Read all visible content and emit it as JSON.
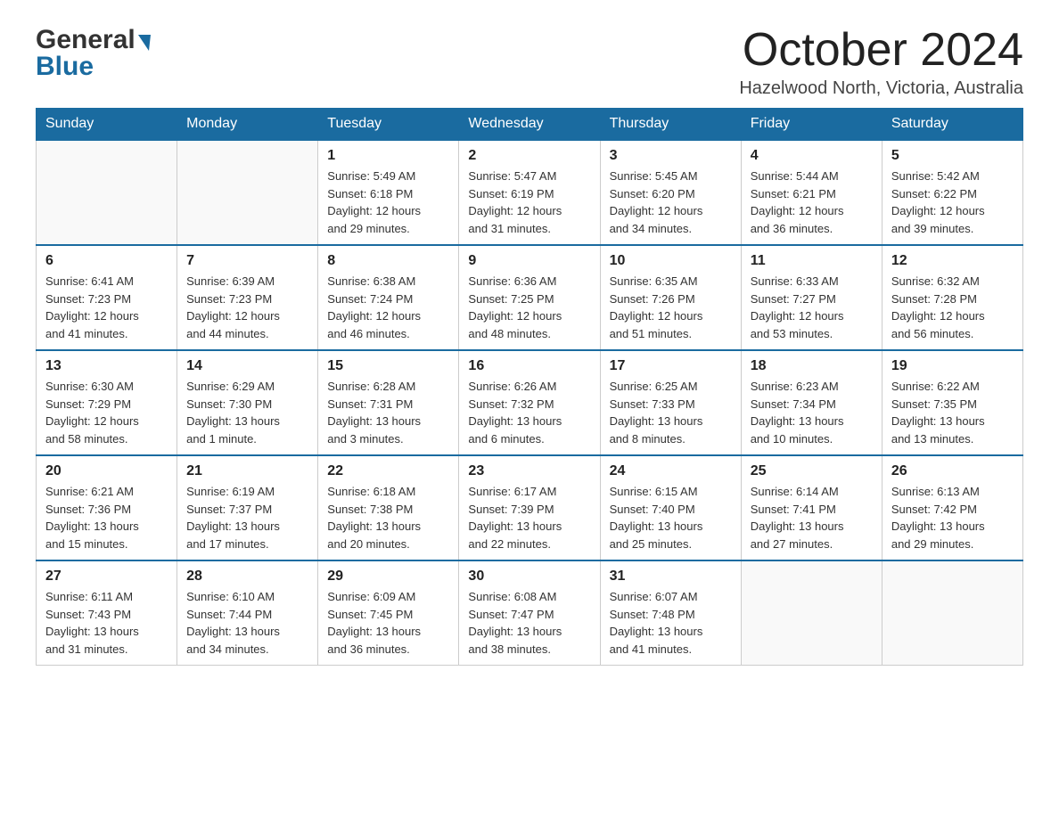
{
  "header": {
    "logo_general": "General",
    "logo_blue": "Blue",
    "month_title": "October 2024",
    "location": "Hazelwood North, Victoria, Australia"
  },
  "days_of_week": [
    "Sunday",
    "Monday",
    "Tuesday",
    "Wednesday",
    "Thursday",
    "Friday",
    "Saturday"
  ],
  "weeks": [
    [
      {
        "day": "",
        "info": ""
      },
      {
        "day": "",
        "info": ""
      },
      {
        "day": "1",
        "info": "Sunrise: 5:49 AM\nSunset: 6:18 PM\nDaylight: 12 hours\nand 29 minutes."
      },
      {
        "day": "2",
        "info": "Sunrise: 5:47 AM\nSunset: 6:19 PM\nDaylight: 12 hours\nand 31 minutes."
      },
      {
        "day": "3",
        "info": "Sunrise: 5:45 AM\nSunset: 6:20 PM\nDaylight: 12 hours\nand 34 minutes."
      },
      {
        "day": "4",
        "info": "Sunrise: 5:44 AM\nSunset: 6:21 PM\nDaylight: 12 hours\nand 36 minutes."
      },
      {
        "day": "5",
        "info": "Sunrise: 5:42 AM\nSunset: 6:22 PM\nDaylight: 12 hours\nand 39 minutes."
      }
    ],
    [
      {
        "day": "6",
        "info": "Sunrise: 6:41 AM\nSunset: 7:23 PM\nDaylight: 12 hours\nand 41 minutes."
      },
      {
        "day": "7",
        "info": "Sunrise: 6:39 AM\nSunset: 7:23 PM\nDaylight: 12 hours\nand 44 minutes."
      },
      {
        "day": "8",
        "info": "Sunrise: 6:38 AM\nSunset: 7:24 PM\nDaylight: 12 hours\nand 46 minutes."
      },
      {
        "day": "9",
        "info": "Sunrise: 6:36 AM\nSunset: 7:25 PM\nDaylight: 12 hours\nand 48 minutes."
      },
      {
        "day": "10",
        "info": "Sunrise: 6:35 AM\nSunset: 7:26 PM\nDaylight: 12 hours\nand 51 minutes."
      },
      {
        "day": "11",
        "info": "Sunrise: 6:33 AM\nSunset: 7:27 PM\nDaylight: 12 hours\nand 53 minutes."
      },
      {
        "day": "12",
        "info": "Sunrise: 6:32 AM\nSunset: 7:28 PM\nDaylight: 12 hours\nand 56 minutes."
      }
    ],
    [
      {
        "day": "13",
        "info": "Sunrise: 6:30 AM\nSunset: 7:29 PM\nDaylight: 12 hours\nand 58 minutes."
      },
      {
        "day": "14",
        "info": "Sunrise: 6:29 AM\nSunset: 7:30 PM\nDaylight: 13 hours\nand 1 minute."
      },
      {
        "day": "15",
        "info": "Sunrise: 6:28 AM\nSunset: 7:31 PM\nDaylight: 13 hours\nand 3 minutes."
      },
      {
        "day": "16",
        "info": "Sunrise: 6:26 AM\nSunset: 7:32 PM\nDaylight: 13 hours\nand 6 minutes."
      },
      {
        "day": "17",
        "info": "Sunrise: 6:25 AM\nSunset: 7:33 PM\nDaylight: 13 hours\nand 8 minutes."
      },
      {
        "day": "18",
        "info": "Sunrise: 6:23 AM\nSunset: 7:34 PM\nDaylight: 13 hours\nand 10 minutes."
      },
      {
        "day": "19",
        "info": "Sunrise: 6:22 AM\nSunset: 7:35 PM\nDaylight: 13 hours\nand 13 minutes."
      }
    ],
    [
      {
        "day": "20",
        "info": "Sunrise: 6:21 AM\nSunset: 7:36 PM\nDaylight: 13 hours\nand 15 minutes."
      },
      {
        "day": "21",
        "info": "Sunrise: 6:19 AM\nSunset: 7:37 PM\nDaylight: 13 hours\nand 17 minutes."
      },
      {
        "day": "22",
        "info": "Sunrise: 6:18 AM\nSunset: 7:38 PM\nDaylight: 13 hours\nand 20 minutes."
      },
      {
        "day": "23",
        "info": "Sunrise: 6:17 AM\nSunset: 7:39 PM\nDaylight: 13 hours\nand 22 minutes."
      },
      {
        "day": "24",
        "info": "Sunrise: 6:15 AM\nSunset: 7:40 PM\nDaylight: 13 hours\nand 25 minutes."
      },
      {
        "day": "25",
        "info": "Sunrise: 6:14 AM\nSunset: 7:41 PM\nDaylight: 13 hours\nand 27 minutes."
      },
      {
        "day": "26",
        "info": "Sunrise: 6:13 AM\nSunset: 7:42 PM\nDaylight: 13 hours\nand 29 minutes."
      }
    ],
    [
      {
        "day": "27",
        "info": "Sunrise: 6:11 AM\nSunset: 7:43 PM\nDaylight: 13 hours\nand 31 minutes."
      },
      {
        "day": "28",
        "info": "Sunrise: 6:10 AM\nSunset: 7:44 PM\nDaylight: 13 hours\nand 34 minutes."
      },
      {
        "day": "29",
        "info": "Sunrise: 6:09 AM\nSunset: 7:45 PM\nDaylight: 13 hours\nand 36 minutes."
      },
      {
        "day": "30",
        "info": "Sunrise: 6:08 AM\nSunset: 7:47 PM\nDaylight: 13 hours\nand 38 minutes."
      },
      {
        "day": "31",
        "info": "Sunrise: 6:07 AM\nSunset: 7:48 PM\nDaylight: 13 hours\nand 41 minutes."
      },
      {
        "day": "",
        "info": ""
      },
      {
        "day": "",
        "info": ""
      }
    ]
  ]
}
